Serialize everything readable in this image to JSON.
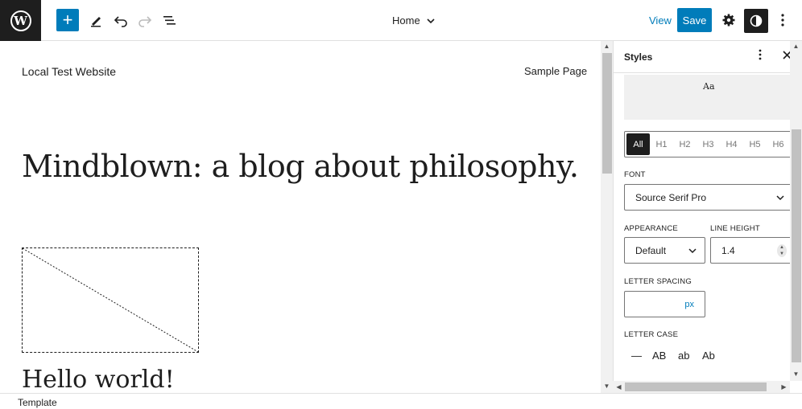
{
  "toolbar": {
    "logo_letter": "W",
    "add_icon": "plus-icon",
    "doc_title": "Home",
    "view_label": "View",
    "save_label": "Save"
  },
  "canvas": {
    "site_title": "Local Test Website",
    "nav_link": "Sample Page",
    "tagline": "Mindblown: a blog about philosophy.",
    "post_title": "Hello world!"
  },
  "sidebar": {
    "title": "Styles",
    "preview_text": "Aa",
    "element_tabs": [
      "All",
      "H1",
      "H2",
      "H3",
      "H4",
      "H5",
      "H6"
    ],
    "font_label": "FONT",
    "font_value": "Source Serif Pro",
    "appearance_label": "APPEARANCE",
    "appearance_value": "Default",
    "line_height_label": "LINE HEIGHT",
    "line_height_value": "1.4",
    "letter_spacing_label": "LETTER SPACING",
    "letter_spacing_unit": "px",
    "letter_case_label": "LETTER CASE",
    "letter_case_options": [
      "—",
      "AB",
      "ab",
      "Ab"
    ]
  },
  "footer": {
    "breadcrumb": "Template"
  },
  "colors": {
    "accent": "#007cba",
    "dark": "#1e1e1e",
    "border": "#e0e0e0"
  }
}
